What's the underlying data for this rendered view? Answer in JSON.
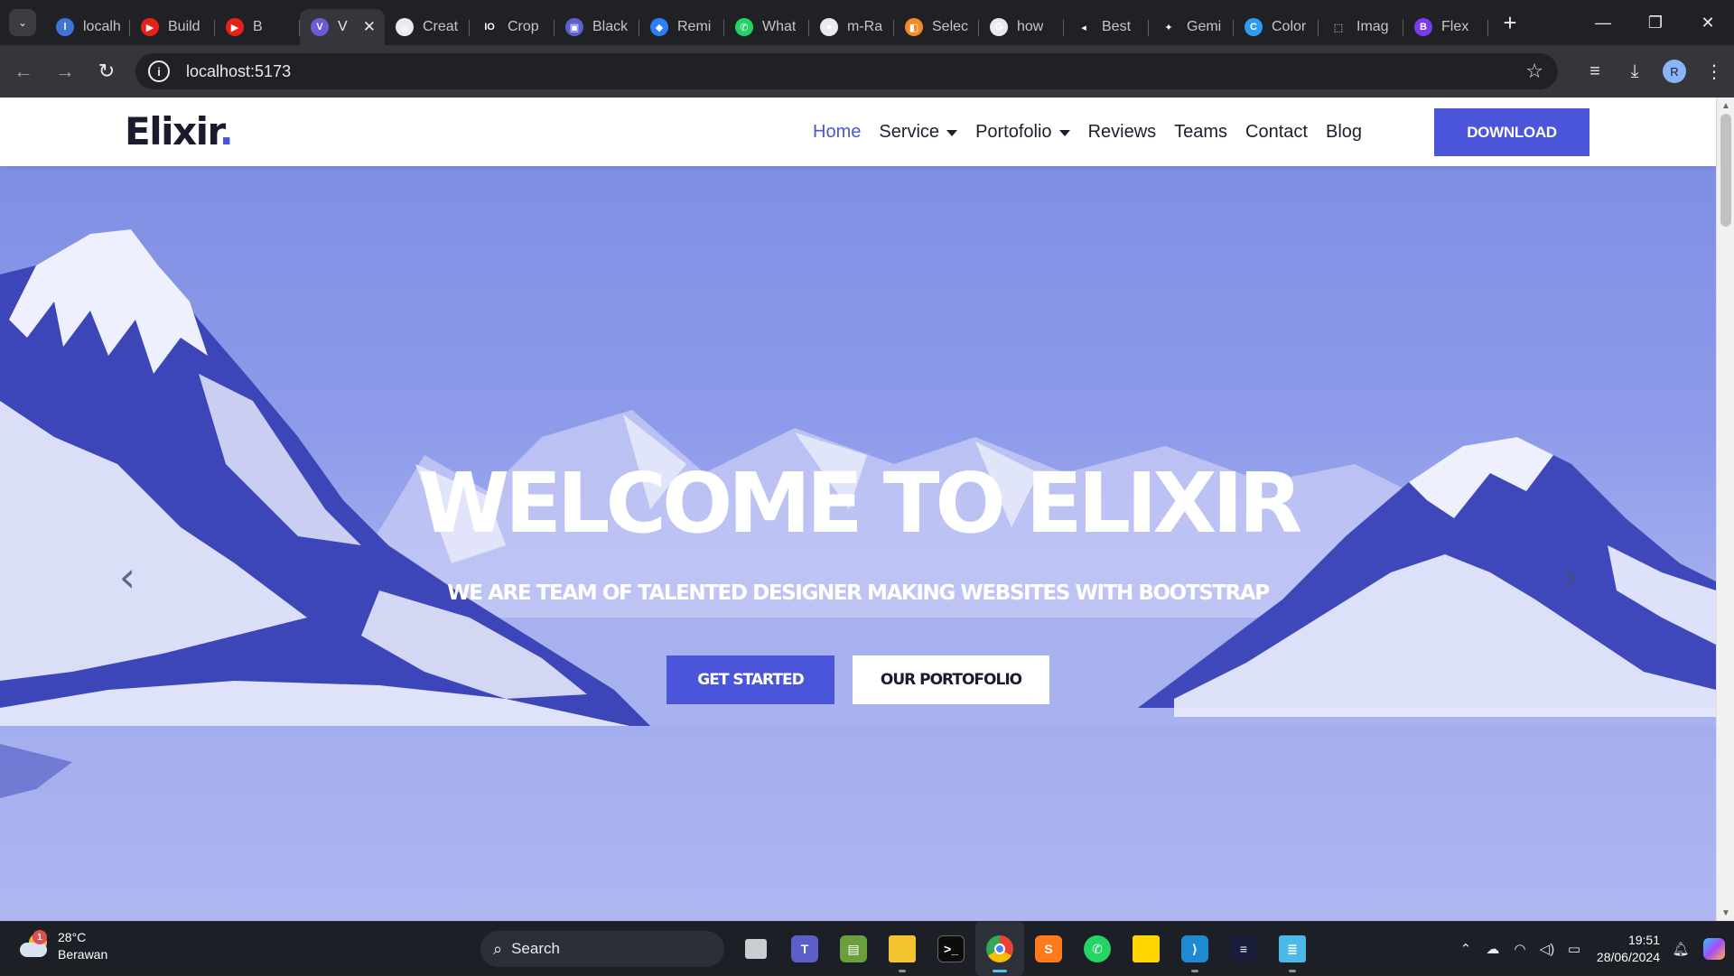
{
  "browser": {
    "tabs": [
      {
        "title": "localh",
        "fav_color": "#3f74d6",
        "fav_text": "l"
      },
      {
        "title": "Build",
        "fav_color": "#e62117",
        "fav_text": "▶"
      },
      {
        "title": "B",
        "fav_color": "#e62117",
        "fav_text": "▶"
      },
      {
        "title": "V",
        "fav_color": "#6b5bd6",
        "fav_text": "V",
        "active": true
      },
      {
        "title": "Creat",
        "fav_color": "#e8eaed",
        "fav_text": "◎"
      },
      {
        "title": "Crop",
        "fav_color": "#202124",
        "fav_text": "IO"
      },
      {
        "title": "Black",
        "fav_color": "#5b5fd0",
        "fav_text": "▣"
      },
      {
        "title": "Remi",
        "fav_color": "#2d7ff9",
        "fav_text": "◆"
      },
      {
        "title": "What",
        "fav_color": "#25d366",
        "fav_text": "✆"
      },
      {
        "title": "m-Ra",
        "fav_color": "#e8eaed",
        "fav_text": "●"
      },
      {
        "title": "Selec",
        "fav_color": "#f28b24",
        "fav_text": "◧"
      },
      {
        "title": "how",
        "fav_color": "#e8eaed",
        "fav_text": "G"
      },
      {
        "title": "Best",
        "fav_color": "#202124",
        "fav_text": "◂"
      },
      {
        "title": "Gemi",
        "fav_color": "#202124",
        "fav_text": "✦"
      },
      {
        "title": "Color",
        "fav_color": "#2e9cf0",
        "fav_text": "C"
      },
      {
        "title": "Imag",
        "fav_color": "#202124",
        "fav_text": "⬚"
      },
      {
        "title": "Flex",
        "fav_color": "#7c3aed",
        "fav_text": "B"
      }
    ],
    "url": "localhost:5173",
    "profile_initial": "R"
  },
  "site": {
    "logo_text": "Elixir",
    "logo_dot": ".",
    "nav": [
      {
        "label": "Home",
        "active": true,
        "dropdown": false
      },
      {
        "label": "Service",
        "active": false,
        "dropdown": true
      },
      {
        "label": "Portofolio",
        "active": false,
        "dropdown": true
      },
      {
        "label": "Reviews",
        "active": false,
        "dropdown": false
      },
      {
        "label": "Teams",
        "active": false,
        "dropdown": false
      },
      {
        "label": "Contact",
        "active": false,
        "dropdown": false
      },
      {
        "label": "Blog",
        "active": false,
        "dropdown": false
      }
    ],
    "download_label": "DOWNLOAD",
    "accent": "#4a55d9"
  },
  "hero": {
    "title": "WELCOME TO ELIXIR",
    "subtitle": "WE ARE TEAM OF TALENTED DESIGNER MAKING WEBSITES WITH BOOTSTRAP",
    "primary_button": "GET STARTED",
    "secondary_button": "OUR PORTOFOLIO",
    "prev_icon": "chevron-left-icon",
    "next_icon": "chevron-right-icon"
  },
  "taskbar": {
    "temperature": "28°C",
    "condition": "Berawan",
    "weather_badge": "1",
    "search_label": "Search",
    "time": "19:51",
    "date": "28/06/2024"
  }
}
